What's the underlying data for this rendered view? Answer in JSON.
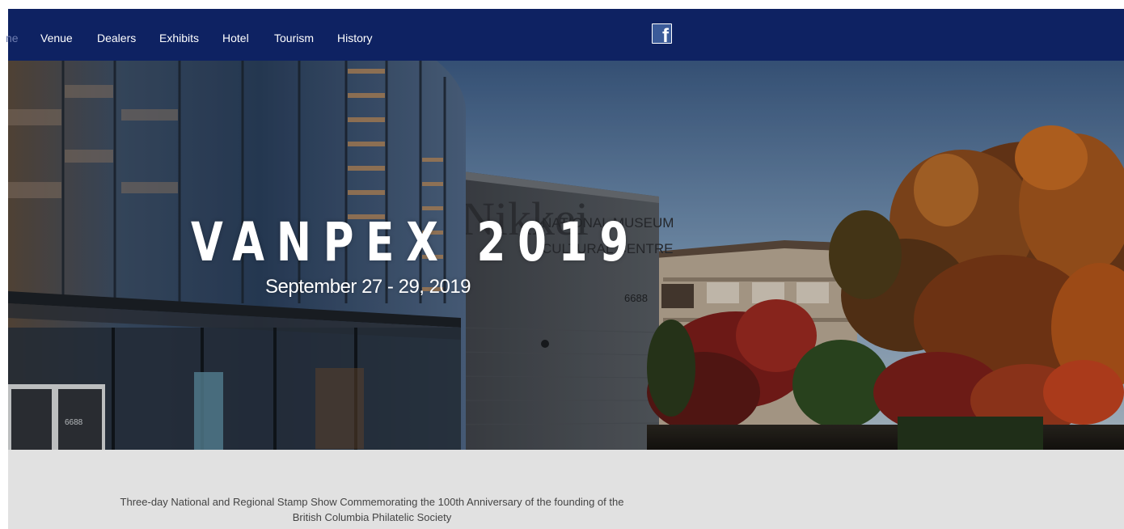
{
  "nav": {
    "items": [
      {
        "label": "ne",
        "partial": true
      },
      {
        "label": "Venue"
      },
      {
        "label": "Dealers"
      },
      {
        "label": "Exhibits"
      },
      {
        "label": "Hotel"
      },
      {
        "label": "Tourism"
      },
      {
        "label": "History"
      }
    ],
    "social_icon": "facebook-icon",
    "social_glyph": "f"
  },
  "hero": {
    "title": "VANPEX 2019",
    "date": "September 27 - 29, 2019",
    "sign_line1": "NATIONAL MUSEUM",
    "sign_line2": "CULTURAL CENTRE",
    "sign_logo": "Nikkei",
    "building_number": "6688",
    "door_number": "6688"
  },
  "info": {
    "line1": "Three-day National and Regional Stamp Show Commemorating the 100th Anniversary of the founding of the",
    "line2": "British Columbia Philatelic Society"
  },
  "colors": {
    "nav_bg": "#0e2262",
    "nav_text": "#ffffff",
    "info_bg": "#e1e1e1",
    "info_text": "#444444",
    "facebook": "#3b5b99"
  }
}
